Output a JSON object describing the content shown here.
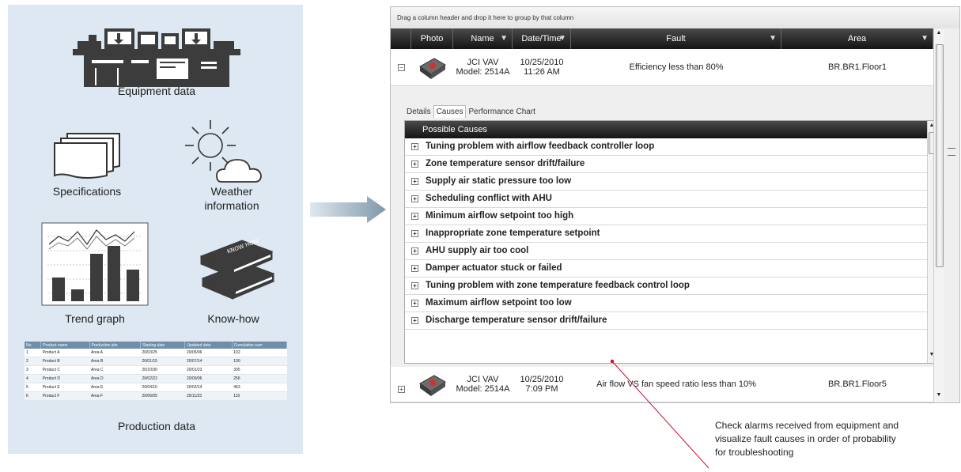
{
  "left": {
    "equipment_label": "Equipment data",
    "specifications_label": "Specifications",
    "weather_label_1": "Weather",
    "weather_label_2": "information",
    "trend_label": "Trend graph",
    "knowhow_label": "Know-how",
    "knowhow_book_text": "KNOW HOW",
    "production_label": "Production data",
    "production_table": {
      "headers": [
        "No.",
        "Product name",
        "Production site",
        "Starting date",
        "Updated date",
        "Cumulative sum"
      ],
      "rows": [
        [
          "1",
          "Product A",
          "Area A",
          "20/03/25",
          "20/05/06",
          "102"
        ],
        [
          "2",
          "Product B",
          "Area B",
          "20/01/15",
          "20/07/14",
          "100"
        ],
        [
          "3",
          "Product C",
          "Area C",
          "20/10/30",
          "20/01/23",
          "305"
        ],
        [
          "4",
          "Product D",
          "Area D",
          "20/02/22",
          "20/09/06",
          "256"
        ],
        [
          "5",
          "Product E",
          "Area E",
          "20/04/10",
          "20/02/14",
          "463"
        ],
        [
          "6",
          "Product F",
          "Area F",
          "20/06/05",
          "20/11/23",
          "110"
        ]
      ]
    }
  },
  "app": {
    "group_hint": "Drag a column header and drop it here to group by that column",
    "columns": {
      "photo": "Photo",
      "name": "Name",
      "datetime": "Date/Time",
      "fault": "Fault",
      "area": "Area"
    },
    "rows": [
      {
        "name_line1": "JCI VAV",
        "name_line2": "Model: 2514A",
        "date": "10/25/2010",
        "time": "11:26 AM",
        "fault": "Efficiency less than 80%",
        "area": "BR.BR1.Floor1",
        "expander": "−"
      },
      {
        "name_line1": "JCI VAV",
        "name_line2": "Model: 2514A",
        "date": "10/25/2010",
        "time": "7:09 PM",
        "fault": "Air flow VS fan speed ratio less than 10%",
        "area": "BR.BR1.Floor5",
        "expander": "+"
      }
    ],
    "tabs": [
      "Details",
      "Causes",
      "Performance Chart"
    ],
    "active_tab": "Causes",
    "causes_header": "Possible Causes",
    "causes": [
      "Tuning problem with airflow feedback controller loop",
      "Zone temperature sensor drift/failure",
      "Supply air static pressure too low",
      "Scheduling conflict with AHU",
      "Minimum airflow setpoint too high",
      "Inappropriate zone temperature setpoint",
      "AHU supply air too cool",
      "Damper actuator stuck or failed",
      "Tuning problem with zone temperature feedback control loop",
      "Maximum airflow setpoint too low",
      "Discharge temperature sensor drift/failure"
    ],
    "expand_glyph": "+"
  },
  "annotation": {
    "line1": "Check alarms received from equipment and",
    "line2": "visualize fault causes in order of probability",
    "line3": "for troubleshooting"
  },
  "colors": {
    "panel_bg": "#dde8f2",
    "header_dark": "#141414",
    "annotation_line": "#c8102e",
    "arrow": "#8fa7b8"
  }
}
